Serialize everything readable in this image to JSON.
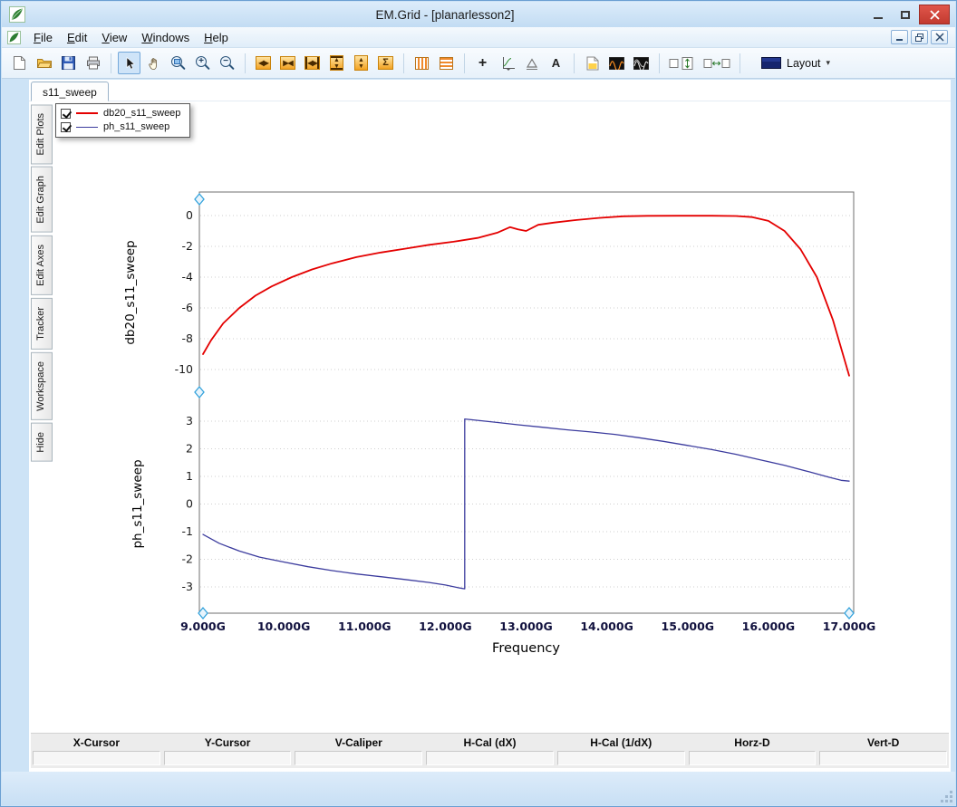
{
  "window": {
    "title": "EM.Grid - [planarlesson2]"
  },
  "menu": {
    "items": [
      "File",
      "Edit",
      "View",
      "Windows",
      "Help"
    ]
  },
  "toolbar": {
    "layout_label": "Layout",
    "glyphs": {
      "expand_x": "◀▶",
      "compress_x": "▶◀",
      "fit_x": "◀▶",
      "arr_up": "▲",
      "arr_down": "▼",
      "autoscale": "Σ",
      "zoom_in": "+",
      "zoom_out": "−",
      "crosshair": "+",
      "text_tool": "A",
      "caret": "▾"
    }
  },
  "side_tabs": {
    "items": [
      "Edit Plots",
      "Edit Graph",
      "Edit Axes",
      "Tracker",
      "Workspace",
      "Hide"
    ]
  },
  "doc": {
    "tab_label": "s11_sweep"
  },
  "legend": {
    "items": [
      {
        "label": "db20_s11_sweep",
        "color": "#e40000",
        "thickness": 2.5,
        "checked": true
      },
      {
        "label": "ph_s11_sweep",
        "color": "#3c3c9e",
        "thickness": 1.5,
        "checked": true
      }
    ]
  },
  "status_table": {
    "headers": [
      "X-Cursor",
      "Y-Cursor",
      "V-Caliper",
      "H-Cal (dX)",
      "H-Cal (1/dX)",
      "Horz-D",
      "Vert-D"
    ],
    "values": [
      "",
      "",
      "",
      "",
      "",
      "",
      ""
    ]
  },
  "chart_data": {
    "type": "line",
    "xlabel": "Frequency",
    "xlim": [
      9,
      17
    ],
    "xticks": [
      9,
      10,
      11,
      12,
      13,
      14,
      15,
      16,
      17
    ],
    "xtick_labels": [
      "9.000G",
      "10.000G",
      "11.000G",
      "12.000G",
      "13.000G",
      "14.000G",
      "15.000G",
      "16.000G",
      "17.000G"
    ],
    "grid": "horizontal-dotted",
    "legend_position": "top-left",
    "subplots": [
      {
        "ylabel": "db20_s11_sweep",
        "yticks": [
          0,
          -2,
          -4,
          -6,
          -8,
          -10
        ],
        "ylim": [
          -11.5,
          1.5
        ],
        "series": [
          {
            "name": "db20_s11_sweep",
            "color": "#e40000",
            "stroke_width": 1.8,
            "x": [
              9.0,
              9.1,
              9.25,
              9.45,
              9.65,
              9.85,
              10.1,
              10.35,
              10.6,
              10.9,
              11.2,
              11.5,
              11.8,
              12.1,
              12.4,
              12.65,
              12.8,
              12.9,
              13.0,
              13.15,
              13.35,
              13.6,
              13.9,
              14.2,
              14.5,
              14.9,
              15.3,
              15.6,
              15.8,
              16.0,
              16.2,
              16.4,
              16.6,
              16.8,
              17.0
            ],
            "y": [
              -9.0,
              -8.1,
              -7.0,
              -6.0,
              -5.2,
              -4.6,
              -4.0,
              -3.5,
              -3.1,
              -2.7,
              -2.4,
              -2.15,
              -1.9,
              -1.7,
              -1.45,
              -1.1,
              -0.75,
              -0.9,
              -1.0,
              -0.6,
              -0.45,
              -0.3,
              -0.15,
              -0.05,
              -0.02,
              -0.01,
              -0.01,
              -0.03,
              -0.1,
              -0.35,
              -1.0,
              -2.2,
              -4.0,
              -6.8,
              -10.4
            ]
          }
        ]
      },
      {
        "ylabel": "ph_s11_sweep",
        "yticks": [
          3,
          2,
          1,
          0,
          -1,
          -2,
          -3
        ],
        "ylim": [
          -3.6,
          3.6
        ],
        "series": [
          {
            "name": "ph_s11_sweep",
            "color": "#3c3c9e",
            "stroke_width": 1.3,
            "x": [
              9.0,
              9.2,
              9.45,
              9.7,
              10.0,
              10.3,
              10.6,
              10.9,
              11.2,
              11.5,
              11.8,
              12.0,
              12.1,
              12.18,
              12.24,
              12.24,
              12.4,
              12.65,
              12.9,
              13.2,
              13.5,
              13.8,
              14.1,
              14.4,
              14.7,
              15.0,
              15.3,
              15.6,
              15.9,
              16.2,
              16.5,
              16.75,
              16.9,
              17.0
            ],
            "y": [
              -1.1,
              -1.42,
              -1.7,
              -1.92,
              -2.1,
              -2.27,
              -2.41,
              -2.53,
              -2.63,
              -2.73,
              -2.84,
              -2.93,
              -2.99,
              -3.04,
              -3.07,
              3.08,
              3.03,
              2.95,
              2.87,
              2.78,
              2.69,
              2.61,
              2.52,
              2.4,
              2.27,
              2.12,
              1.97,
              1.8,
              1.6,
              1.4,
              1.17,
              0.97,
              0.86,
              0.83
            ]
          }
        ]
      }
    ]
  }
}
